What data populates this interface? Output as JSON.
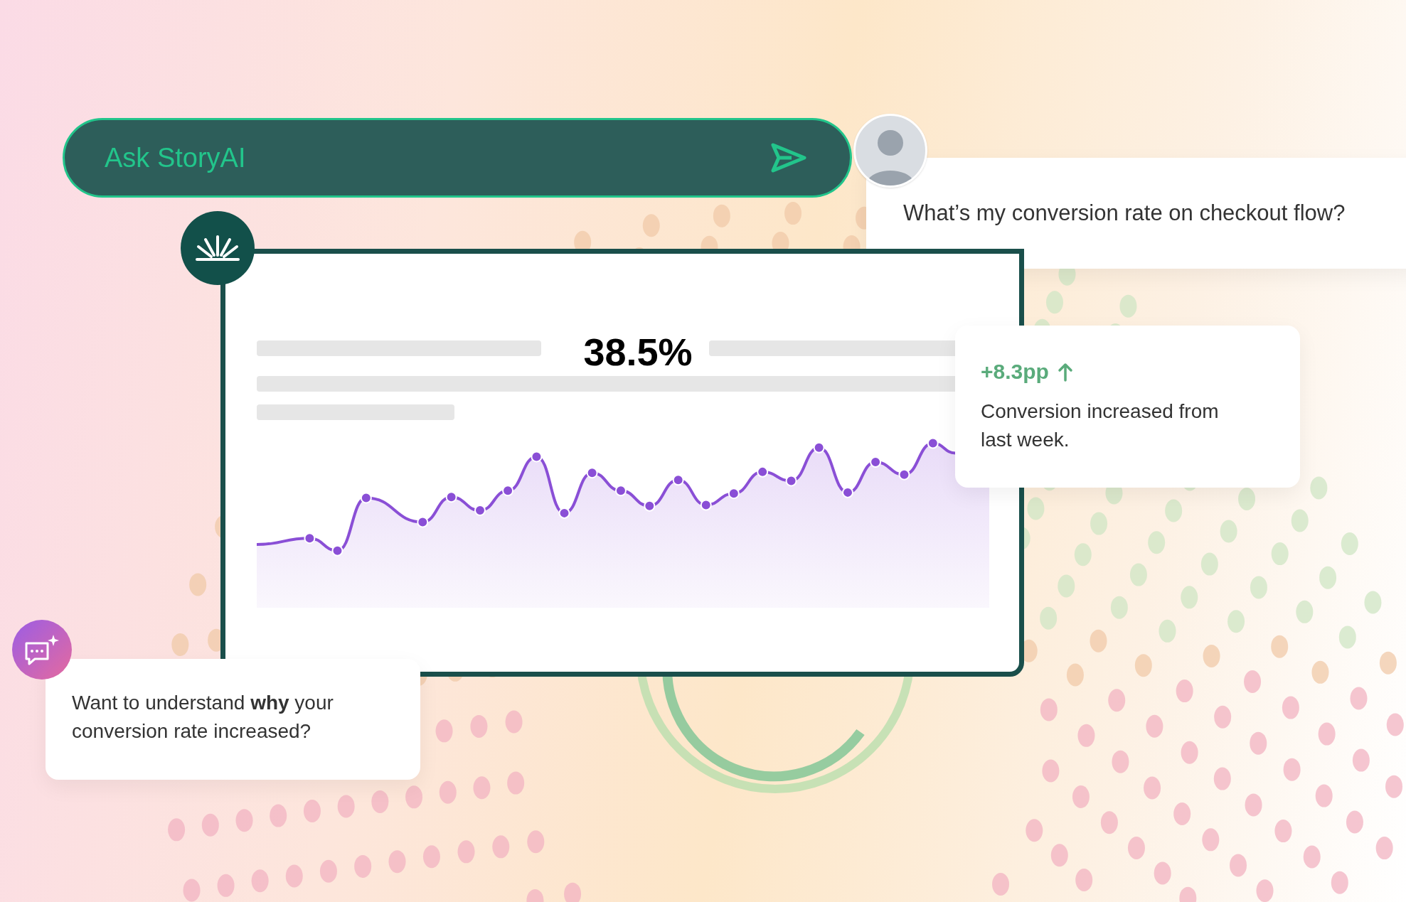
{
  "search_bar": {
    "placeholder": "Ask StoryAI"
  },
  "user_question": {
    "text": "What’s my conversion rate on checkout flow?"
  },
  "dashboard_card": {
    "metric": "38.5%"
  },
  "insight_card": {
    "change": "+8.3pp",
    "description": "Conversion increased from last week."
  },
  "suggestion_card": {
    "text": "Want to understand **why** your conversion rate increased?"
  }
}
